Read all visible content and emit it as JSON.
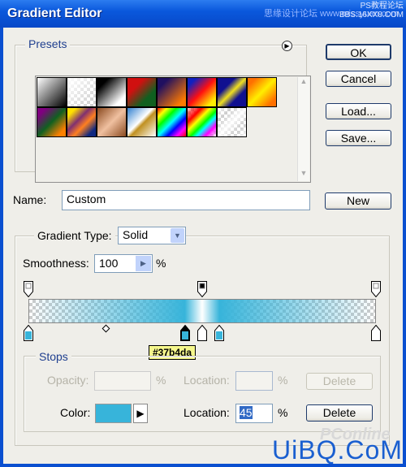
{
  "window": {
    "title": "Gradient Editor"
  },
  "watermarks": {
    "top_left": "思缘设计论坛 www.missyuan.com",
    "top_right_1": "PS教程论坛",
    "top_right_2": "BBS.16XX8.COM",
    "bottom_1": "PConline",
    "bottom_2": "UiBQ.CoM"
  },
  "presets": {
    "label": "Presets",
    "menu_icon": "circle-arrow-right-icon",
    "swatches": [
      "linear-gradient(135deg,#fff,#000)",
      "linear-gradient(135deg,#fff,rgba(255,255,255,0))",
      "linear-gradient(135deg,#000 20%,#fff 80%)",
      "linear-gradient(135deg,#d01010 30%,#106020 70%)",
      "linear-gradient(135deg,#201060 20%,#ff7a00 85%)",
      "linear-gradient(135deg,#1020c0 15%,#ff1010 50%,#ffee00 85%)",
      "linear-gradient(135deg,#101090 30%,#f0e020 50%,#101090 70%)",
      "linear-gradient(135deg,#ff7000 15%,#ffee00 50%,#ff7000 85%)",
      "linear-gradient(135deg,#800080 15%,#106020 50%,#ff8000 85%)",
      "linear-gradient(135deg,#ffe000 15%,#803070 40%,#ff8020 60%,#102880 85%)",
      "linear-gradient(135deg,#8a4a20,#f0c0a0 50%,#8a4a20)",
      "linear-gradient(135deg,#3080d0,#fff 45%,#c09020 55%,#fff)",
      "linear-gradient(135deg,#f00,#ff0,#0f0,#0ff,#00f,#f0f,#f00)",
      "linear-gradient(135deg,rgba(255,0,0,0.2),#f00 25%,#ff0 40%,#0f0 55%,#0ff 65%,#f0f 80%,rgba(255,255,255,0.2))",
      "linear-gradient(135deg,rgba(255,255,255,0.9),rgba(255,255,255,0) 25%,rgba(255,255,255,0.9) 50%,rgba(255,255,255,0) 75%,rgba(255,255,255,0.9))"
    ]
  },
  "buttons": {
    "ok": "OK",
    "cancel": "Cancel",
    "load": "Load...",
    "save": "Save...",
    "new": "New"
  },
  "name": {
    "label": "Name:",
    "value": "Custom"
  },
  "gradient": {
    "type_label": "Gradient Type:",
    "type_value": "Solid",
    "smoothness_label": "Smoothness:",
    "smoothness_value": "100",
    "smoothness_unit": "%",
    "color_stop_locations": [
      0,
      45,
      50,
      55,
      100
    ],
    "opacity_stop_locations": [
      0,
      50,
      100
    ],
    "tooltip": "#37b4da",
    "accent_color": "#37b4da"
  },
  "stops": {
    "label": "Stops",
    "opacity_label": "Opacity:",
    "opacity_value": "",
    "opacity_unit": "%",
    "opacity_location_label": "Location:",
    "opacity_location_value": "",
    "opacity_location_unit": "%",
    "opacity_delete": "Delete",
    "color_label": "Color:",
    "color_value": "#37b4da",
    "color_location_label": "Location:",
    "color_location_value": "45",
    "color_location_unit": "%",
    "color_delete": "Delete"
  }
}
